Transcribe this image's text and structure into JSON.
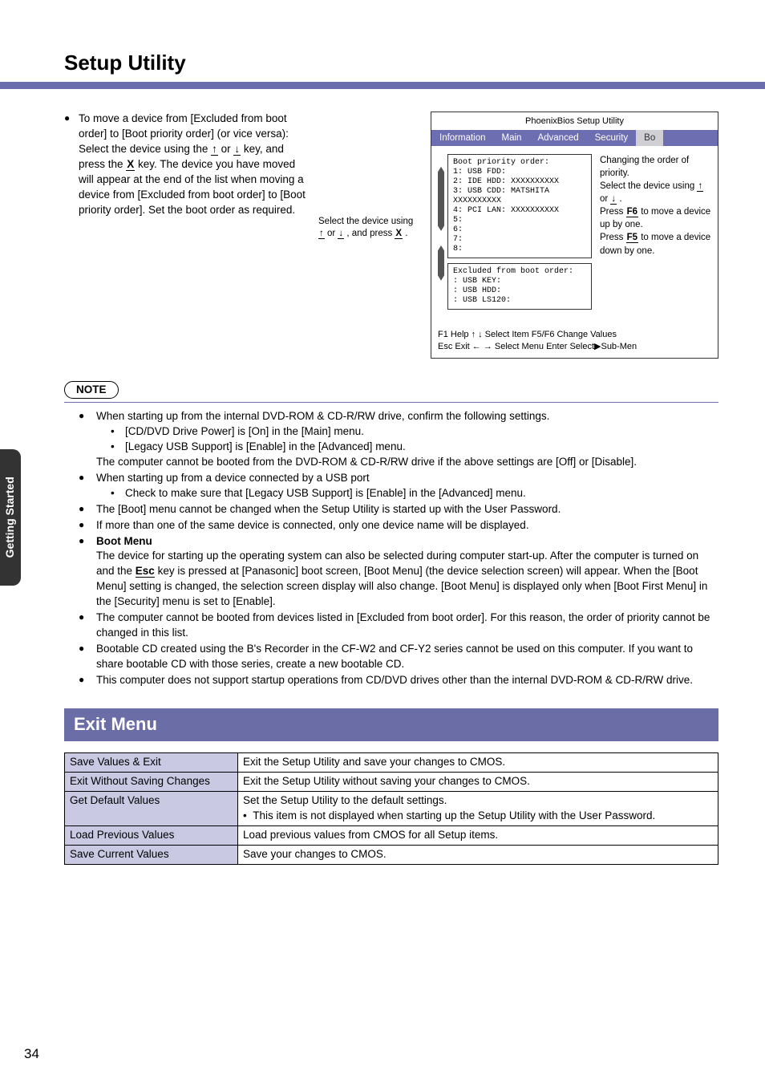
{
  "title": "Setup Utility",
  "upper": {
    "bullet_intro": "To move a device from [Excluded from boot order] to [Boot priority order] (or vice versa):",
    "instr_1a": "Select the device using the ",
    "instr_1b": " or ",
    "instr_1c": " key, and press the ",
    "instr_1d": " key. The device you have moved will appear at the end of the list when moving a device from [Excluded from boot order] to [Boot priority order]. Set the boot order as required.",
    "key_up": "↑",
    "key_down": "↓",
    "key_x": "X",
    "mid_1": "Select the device using ",
    "mid_2": " or ",
    "mid_3": " , and press ",
    "mid_4": " .",
    "bios": {
      "title": "PhoenixBios Setup Utility",
      "tabs": [
        "Information",
        "Main",
        "Advanced",
        "Security",
        "Bo"
      ],
      "box1_head": "Boot priority order:",
      "box1_lines": [
        "1:  USB FDD:",
        "2:  IDE HDD:   XXXXXXXXXX",
        "3:  USB CDD:   MATSHITA XXXXXXXXXX",
        "4:  PCI LAN:   XXXXXXXXXX",
        "5:",
        "6:",
        "7:",
        "8:"
      ],
      "box2_head": "Excluded from boot order:",
      "box2_lines": [
        ":  USB KEY:",
        ":  USB HDD:",
        ":  USB LS120:"
      ],
      "right_1": "Changing the order of priority.",
      "right_2a": "Select the device using ",
      "right_2b": " or ",
      "right_2c": " .",
      "right_3a": "Press ",
      "right_3b": " to move a device up by one.",
      "right_4a": "Press ",
      "right_4b": " to move a device down by one.",
      "key_f6": "F6",
      "key_f5": "F5",
      "foot_1": "F1   Help   ↑ ↓ Select Item    F5/F6 Change Values",
      "foot_2": "Esc Exit   ← → Select Menu  Enter  Select▶Sub-Men"
    }
  },
  "note_label": "NOTE",
  "notes": [
    {
      "main": "When starting up from the internal DVD-ROM & CD-R/RW drive, confirm the following settings.",
      "subs": [
        "[CD/DVD Drive Power] is [On] in the [Main] menu.",
        "[Legacy USB Support] is [Enable] in the [Advanced] menu."
      ],
      "tail": "The computer cannot be booted from the DVD-ROM & CD-R/RW drive if the above settings are [Off] or [Disable]."
    },
    {
      "main": "When starting up from a device connected by a USB port",
      "subs": [
        "Check to make sure that [Legacy USB Support] is [Enable] in the [Advanced] menu."
      ]
    },
    {
      "main": "The [Boot] menu cannot be changed when the Setup Utility is started up with the User Password."
    },
    {
      "main": "If more than one of the same device is connected, only one device name will be displayed."
    },
    {
      "bold_lead": "Boot Menu",
      "main_a": "The device for starting up the operating system can also be selected during computer start-up.  After the computer is turned on and the ",
      "main_key": "Esc",
      "main_b": " key is pressed at [Panasonic] boot screen, [Boot Menu] (the device selection screen) will appear. When the [Boot Menu] setting is changed, the selection screen display will also change. [Boot Menu] is displayed only when [Boot First Menu] in the [Security] menu is set to [Enable]."
    },
    {
      "main": "The computer cannot be booted from devices listed in [Excluded from boot order]. For this reason, the order of priority cannot be changed in this list."
    },
    {
      "main": "Bootable CD created using the B's Recorder in the CF-W2 and CF-Y2 series cannot be used on this computer. If you want to share bootable CD with those series, create a new bootable CD."
    },
    {
      "main": "This computer does not support startup operations from CD/DVD drives other than the internal DVD-ROM & CD-R/RW drive."
    }
  ],
  "exit_heading": "Exit Menu",
  "exit_table": [
    {
      "name": "Save Values & Exit",
      "desc": "Exit the Setup Utility and save your changes to CMOS."
    },
    {
      "name": "Exit Without Saving Changes",
      "desc": "Exit the Setup Utility without saving your changes to CMOS."
    },
    {
      "name": "Get Default Values",
      "desc": "Set the Setup Utility to the default settings.",
      "desc2": "This item is not displayed when starting up the Setup Utility with the User Password."
    },
    {
      "name": "Load Previous Values",
      "desc": "Load previous values from CMOS for all Setup items."
    },
    {
      "name": "Save Current Values",
      "desc": "Save your changes to CMOS."
    }
  ],
  "side_tab": "Getting Started",
  "page_num": "34"
}
